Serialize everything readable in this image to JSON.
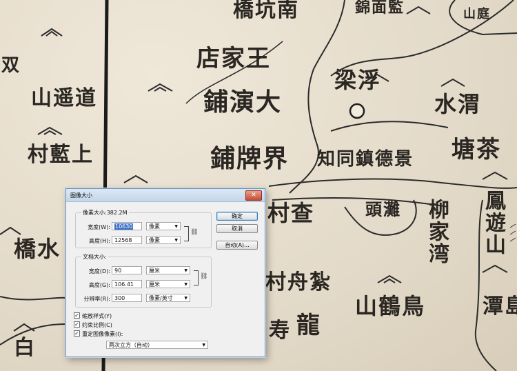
{
  "map": {
    "labels": [
      "橋坑南",
      "錦面監",
      "山庭",
      "双",
      "店家王",
      "梁浮",
      "山遥道",
      "鋪演大",
      "水渭",
      "塘茶",
      "村藍上",
      "鋪牌界",
      "知同鎮德景",
      "村查",
      "頭灘",
      "柳家湾",
      "鳳遊山",
      "橋水",
      "村舟紮",
      "山鶴鳥",
      "潭島",
      "龍",
      "寿",
      "白"
    ]
  },
  "dialog": {
    "title": "图像大小",
    "close_glyph": "✕",
    "pixel_dims": {
      "legend": "像素大小:382.2M",
      "width_label": "宽度(W):",
      "width_value": "10630",
      "width_unit": "像素",
      "height_label": "高度(H):",
      "height_value": "12568",
      "height_unit": "像素"
    },
    "doc_size": {
      "legend": "文档大小:",
      "width_label": "宽度(D):",
      "width_value": "90",
      "width_unit": "厘米",
      "height_label": "高度(G):",
      "height_value": "106.41",
      "height_unit": "厘米",
      "res_label": "分辨率(R):",
      "res_value": "300",
      "res_unit": "像素/英寸"
    },
    "buttons": {
      "ok": "确定",
      "cancel": "取消",
      "auto": "自动(A)..."
    },
    "options": {
      "scale_styles": "缩放样式(Y)",
      "constrain": "约束比例(C)",
      "resample": "重定图像像素(I):",
      "resample_method": "两次立方（自动）",
      "checked_glyph": "✓"
    },
    "dropdown_arrow": "▼",
    "chain_icon": "⛓"
  }
}
